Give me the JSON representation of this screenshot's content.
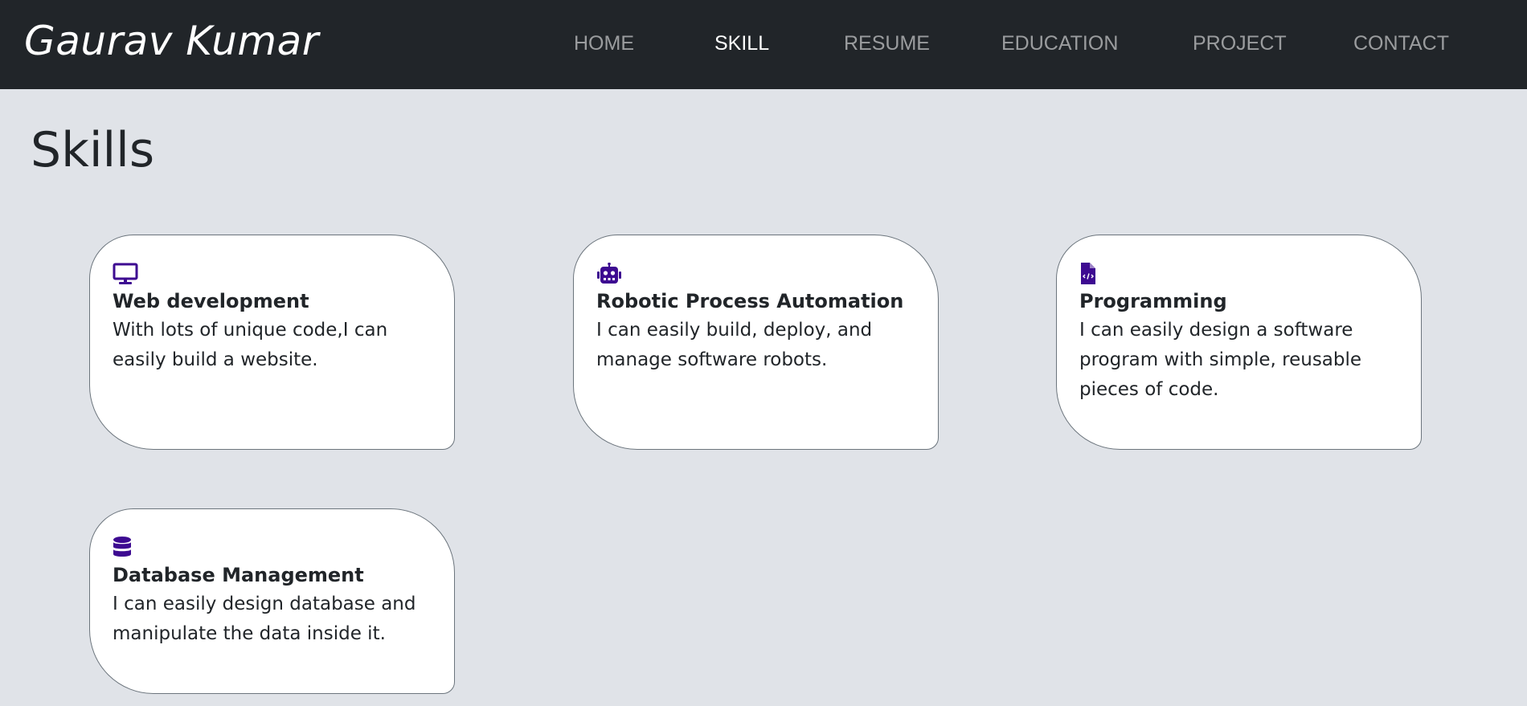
{
  "navbar": {
    "brand": "Gaurav Kumar",
    "items": [
      {
        "label": "HOME",
        "active": false
      },
      {
        "label": "SKILL",
        "active": true
      },
      {
        "label": "RESUME",
        "active": false
      },
      {
        "label": "EDUCATION",
        "active": false
      },
      {
        "label": "PROJECT",
        "active": false
      },
      {
        "label": "CONTACT",
        "active": false
      }
    ]
  },
  "page": {
    "title": "Skills"
  },
  "skills": [
    {
      "icon": "monitor-icon",
      "title": "Web development",
      "description": "With lots of unique code,I can easily build a website."
    },
    {
      "icon": "robot-icon",
      "title": "Robotic Process Automation",
      "description": "I can easily build, deploy, and manage software robots."
    },
    {
      "icon": "code-file-icon",
      "title": "Programming",
      "description": "I can easily design a software program with simple, reusable pieces of code."
    },
    {
      "icon": "database-icon",
      "title": "Database Management",
      "description": "I can easily design database and manipulate the data inside it."
    }
  ],
  "colors": {
    "navbar_bg": "#212529",
    "page_bg": "#e0e3e8",
    "icon": "#3d0a91",
    "nav_inactive": "rgba(255,255,255,0.55)",
    "nav_active": "#ffffff"
  }
}
